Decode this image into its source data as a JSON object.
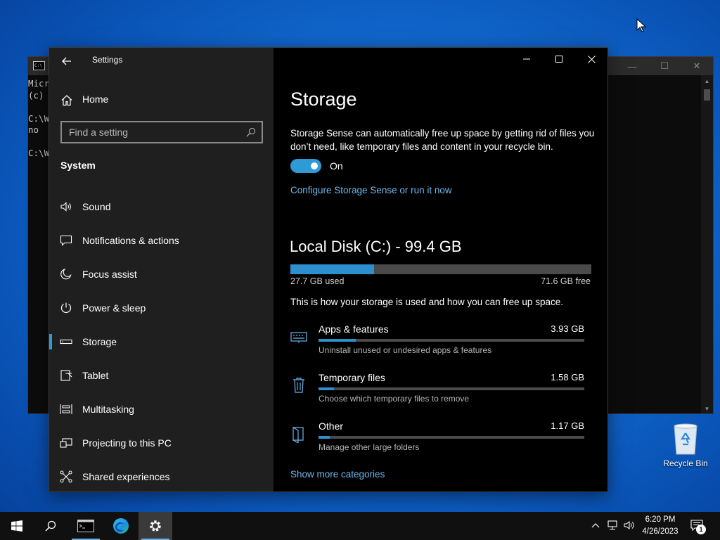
{
  "console": {
    "icon_text": "C:\\",
    "lines": [
      "Micr",
      "(c)",
      "",
      "C:\\W",
      "no",
      "",
      "C:\\W"
    ],
    "controls": {
      "minimize": "—",
      "maximize": "☐",
      "close": "✕"
    }
  },
  "settings": {
    "title": "Settings",
    "home_label": "Home",
    "search_placeholder": "Find a setting",
    "section_label": "System",
    "nav": [
      {
        "label": "Sound",
        "icon": "speaker-icon"
      },
      {
        "label": "Notifications & actions",
        "icon": "message-icon"
      },
      {
        "label": "Focus assist",
        "icon": "moon-icon"
      },
      {
        "label": "Power & sleep",
        "icon": "power-icon"
      },
      {
        "label": "Storage",
        "icon": "drive-icon",
        "active": true
      },
      {
        "label": "Tablet",
        "icon": "tablet-icon"
      },
      {
        "label": "Multitasking",
        "icon": "multitasking-icon"
      },
      {
        "label": "Projecting to this PC",
        "icon": "projector-icon"
      },
      {
        "label": "Shared experiences",
        "icon": "share-icon"
      }
    ],
    "page_title": "Storage",
    "storage_sense_desc": "Storage Sense can automatically free up space by getting rid of files you don’t need, like temporary files and content in your recycle bin.",
    "storage_sense_state": "On",
    "configure_link": "Configure Storage Sense or run it now",
    "disk": {
      "title": "Local Disk (C:) - 99.4 GB",
      "used_label": "27.7 GB used",
      "free_label": "71.6 GB free",
      "used_fraction": 0.279
    },
    "usage_desc": "This is how your storage is used and how you can free up space.",
    "categories": [
      {
        "name": "Apps & features",
        "size": "3.93 GB",
        "sub": "Uninstall unused or undesired apps & features",
        "fraction": 0.14,
        "icon": "keyboard-icon"
      },
      {
        "name": "Temporary files",
        "size": "1.58 GB",
        "sub": "Choose which temporary files to remove",
        "fraction": 0.057,
        "icon": "trash-icon"
      },
      {
        "name": "Other",
        "size": "1.17 GB",
        "sub": "Manage other large folders",
        "fraction": 0.042,
        "icon": "folder-icon"
      }
    ],
    "more_link": "Show more categories"
  },
  "desktop": {
    "recycle_bin_label": "Recycle Bin"
  },
  "taskbar": {
    "time": "6:20 PM",
    "date": "4/26/2023",
    "notification_count": "1"
  },
  "colors": {
    "accent": "#2e9bd6",
    "link": "#6cb8ee",
    "sidebar_bg": "#1f1f1f",
    "content_bg": "#000000"
  }
}
